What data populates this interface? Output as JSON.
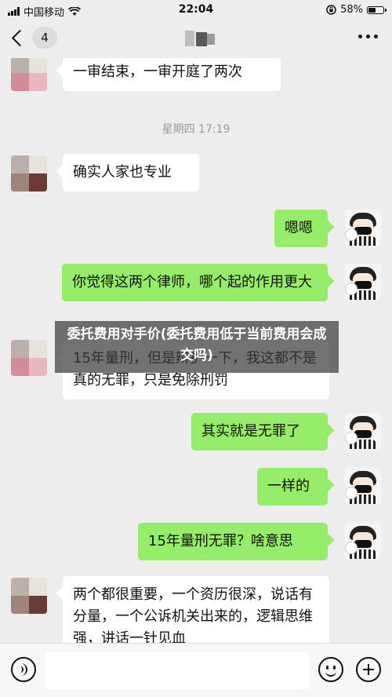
{
  "status_bar": {
    "carrier": "中国移动",
    "time": "22:04",
    "battery_percent": "58%",
    "battery_level": 0.58,
    "icons": [
      "signal-icon",
      "wifi-icon",
      "screen-lock-icon",
      "battery-icon"
    ]
  },
  "nav": {
    "unread_count": "4",
    "title_hidden": true,
    "icons": [
      "back-chevron-icon",
      "more-dots-icon"
    ]
  },
  "messages": [
    {
      "side": "left",
      "text": "一审结束，一审开庭了两次"
    },
    {
      "type": "time",
      "text": "星期四 17:19"
    },
    {
      "side": "left",
      "text": "确实人家也专业"
    },
    {
      "side": "right",
      "text": "嗯嗯"
    },
    {
      "side": "right",
      "text": "你觉得这两个律师，哪个起的作用更大"
    },
    {
      "side": "left",
      "text": "15年量刑，但是辩护一下，我这都不是真的无罪，只是免除刑罚"
    },
    {
      "side": "right",
      "text": "其实就是无罪了"
    },
    {
      "side": "right",
      "text": "一样的"
    },
    {
      "side": "right",
      "text": "15年量刑无罪？啥意思"
    },
    {
      "side": "left",
      "text": "两个都很重要，一个资历很深，说话有分量，一个公诉机关出来的，逻辑思维强，讲话一针见血"
    }
  ],
  "overlay": {
    "text": "委托费用对手价(委托费用低于当前费用会成交吗)"
  },
  "input_bar": {
    "placeholder": "",
    "icons": [
      "voice-icon",
      "emoji-icon",
      "plus-icon"
    ]
  },
  "colors": {
    "background": "#ededed",
    "sent_bubble": "#95ec69",
    "received_bubble": "#ffffff"
  }
}
